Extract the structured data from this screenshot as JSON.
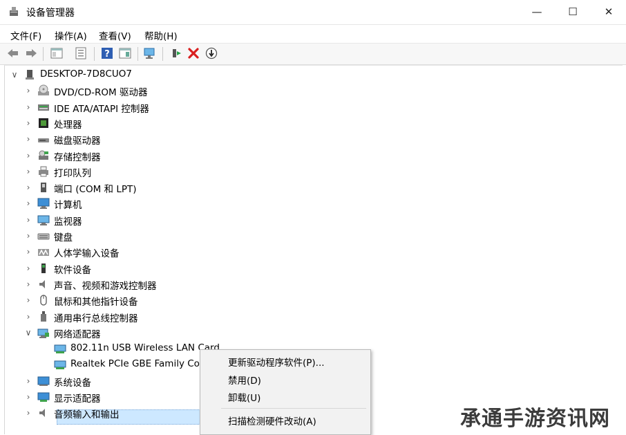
{
  "window": {
    "title": "设备管理器",
    "minimize_glyph": "—",
    "maximize_glyph": "☐",
    "close_glyph": "✕"
  },
  "menu": [
    "文件(F)",
    "操作(A)",
    "查看(V)",
    "帮助(H)"
  ],
  "toolbar": [
    "back-icon",
    "forward-icon",
    "show-hide-console-icon",
    "properties-icon",
    "help-icon",
    "action-pane-icon",
    "scan-hardware-icon",
    "update-driver-icon",
    "uninstall-icon",
    "disable-icon"
  ],
  "tree": {
    "root": "DESKTOP-7D8CUO7",
    "categories": [
      {
        "label": "DVD/CD-ROM 驱动器",
        "icon": "dvd-drive-icon"
      },
      {
        "label": "IDE ATA/ATAPI 控制器",
        "icon": "ide-controller-icon"
      },
      {
        "label": "处理器",
        "icon": "processor-icon"
      },
      {
        "label": "磁盘驱动器",
        "icon": "disk-drive-icon"
      },
      {
        "label": "存储控制器",
        "icon": "storage-controller-icon"
      },
      {
        "label": "打印队列",
        "icon": "printer-icon"
      },
      {
        "label": "端口 (COM 和 LPT)",
        "icon": "port-icon"
      },
      {
        "label": "计算机",
        "icon": "computer-icon"
      },
      {
        "label": "监视器",
        "icon": "monitor-icon"
      },
      {
        "label": "键盘",
        "icon": "keyboard-icon"
      },
      {
        "label": "人体学输入设备",
        "icon": "hid-icon"
      },
      {
        "label": "软件设备",
        "icon": "software-device-icon"
      },
      {
        "label": "声音、视频和游戏控制器",
        "icon": "sound-icon"
      },
      {
        "label": "鼠标和其他指针设备",
        "icon": "mouse-icon"
      },
      {
        "label": "通用串行总线控制器",
        "icon": "usb-icon"
      },
      {
        "label": "网络适配器",
        "icon": "network-adapter-icon"
      }
    ],
    "network_children": [
      "802.11n USB Wireless LAN Card",
      "Realtek PCIe GBE Family Controller"
    ],
    "after": [
      {
        "label": "系统设备",
        "icon": "system-device-icon"
      },
      {
        "label": "显示适配器",
        "icon": "display-adapter-icon"
      },
      {
        "label": "音频输入和输出",
        "icon": "audio-io-icon"
      }
    ]
  },
  "context_menu": [
    "更新驱动程序软件(P)...",
    "禁用(D)",
    "卸载(U)",
    "扫描检测硬件改动(A)"
  ],
  "watermark": "承通手游资讯网",
  "colors": {
    "selection": "#cde8ff",
    "accent": "#1e7fd6"
  }
}
